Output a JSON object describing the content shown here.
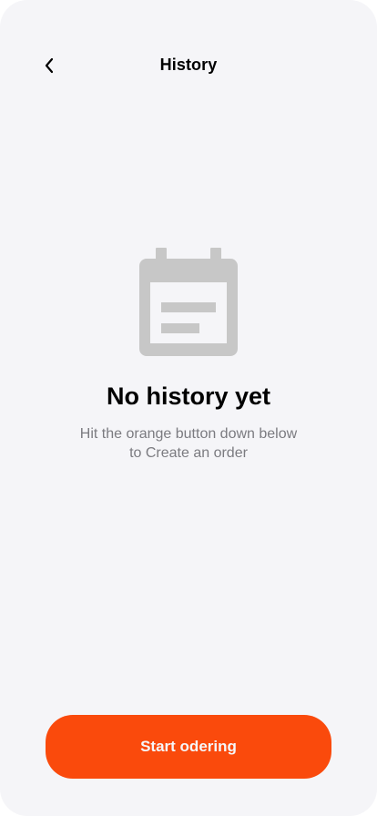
{
  "header": {
    "back_icon": "chevron-left-icon",
    "title": "History"
  },
  "empty_state": {
    "icon": "calendar-icon",
    "icon_color": "#c7c7c7",
    "title": "No history yet",
    "subtitle": "Hit the orange button down below to Create an order"
  },
  "cta": {
    "label": "Start odering",
    "color": "#fa4a0c"
  },
  "colors": {
    "background": "#f5f5f8",
    "accent": "#fa4a0c",
    "subtitle_text": "#7b7b80"
  }
}
